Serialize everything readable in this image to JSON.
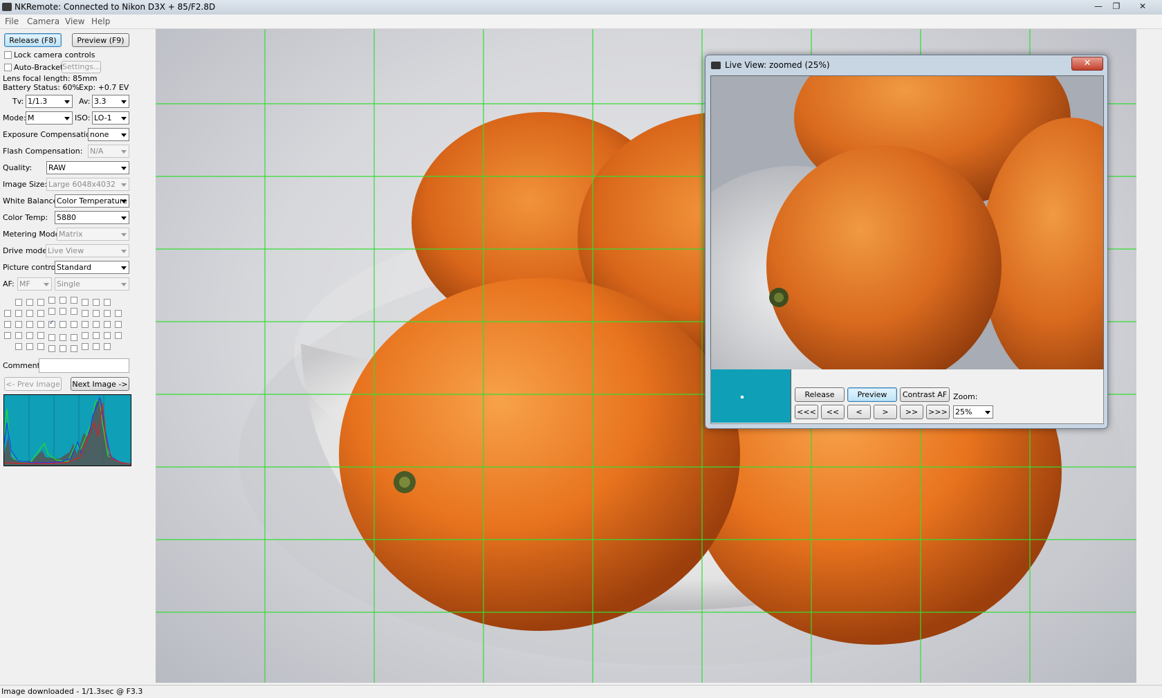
{
  "window": {
    "title": "NKRemote: Connected to Nikon D3X + 85/F2.8D",
    "controls": [
      "—",
      "❐",
      "✕"
    ]
  },
  "menu": [
    "File",
    "Camera",
    "View",
    "Help"
  ],
  "left": {
    "release_btn": "Release (F8)",
    "preview_btn": "Preview (F9)",
    "lock_label": "Lock camera controls",
    "autobracket_label": "Auto-Bracket",
    "settings_btn": "Settings...",
    "lens_focal": "Lens focal length: 85mm",
    "battery": "Battery Status: 60%",
    "exposure": "Exp: +0.7 EV",
    "tv_label": "Tv:",
    "tv_value": "1/1.3",
    "av_label": "Av:",
    "av_value": "3.3",
    "mode_label": "Mode:",
    "mode_value": "M",
    "iso_label": "ISO:",
    "iso_value": "LO-1",
    "expcomp_label": "Exposure Compensation:",
    "expcomp_value": "none",
    "flash_label": "Flash Compensation:",
    "flash_value": "N/A",
    "quality_label": "Quality:",
    "quality_value": "RAW",
    "imagesize_label": "Image Size:",
    "imagesize_value": "Large 6048x4032",
    "wb_label": "White Balance:",
    "wb_value": "Color Temperature",
    "colortemp_label": "Color Temp:",
    "colortemp_value": "5880",
    "metering_label": "Metering Mode:",
    "metering_value": "Matrix",
    "drive_label": "Drive mode:",
    "drive_value": "Live View",
    "picture_label": "Picture control:",
    "picture_value": "Standard",
    "af_label": "AF:",
    "af_value": "MF",
    "af_mode_value": "Single",
    "comment_label": "Comment:",
    "comment_value": "",
    "prev_btn": "<- Prev Image",
    "next_btn": "Next Image ->"
  },
  "liveview": {
    "title": "Live View: zoomed (25%)",
    "close": "✕",
    "release_btn": "Release",
    "preview_btn": "Preview",
    "contrast_btn": "Contrast AF",
    "zoom_label": "Zoom:",
    "zoom_value": "25%",
    "nav": [
      "<<<",
      "<<",
      "<",
      ">",
      ">>",
      ">>>"
    ]
  },
  "status": "Image downloaded - 1/1.3sec @ F3.3",
  "colors": {
    "grid": "#33dd33",
    "histogram_bg": "#0f9fb7",
    "orange": "#e8731e"
  }
}
